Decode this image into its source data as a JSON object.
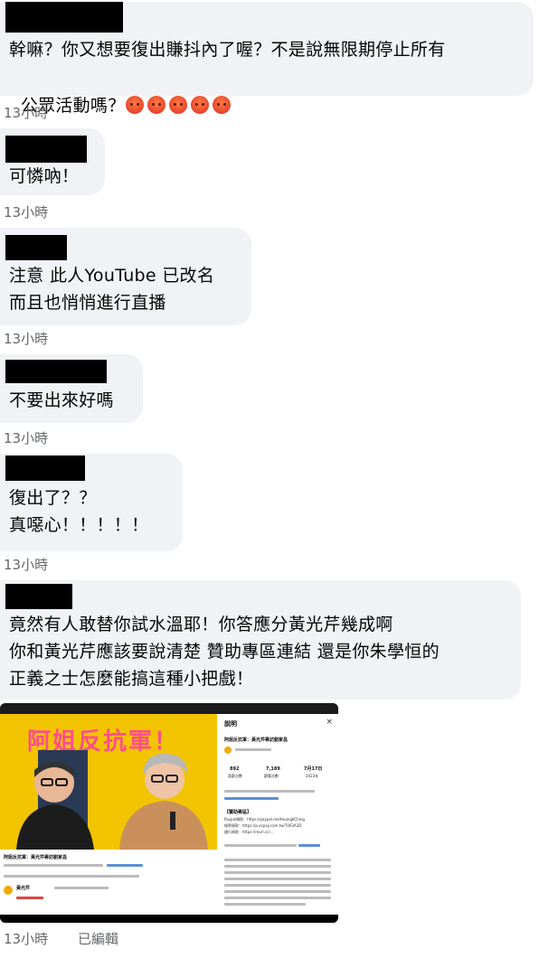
{
  "comments": [
    {
      "lines": [
        "幹嘛？你又想要復出賺抖內了喔？不是說無限期停止所有",
        "公眾活動嗎？"
      ],
      "reaction_emoji": "angry-face",
      "reaction_count_display": 5,
      "time": "13小時"
    },
    {
      "lines": [
        "可憐吶！"
      ],
      "time": "13小時"
    },
    {
      "lines": [
        "注意 此人YouTube 已改名",
        "而且也悄悄進行直播"
      ],
      "time": "13小時"
    },
    {
      "lines": [
        "不要出來好嗎"
      ],
      "time": "13小時"
    },
    {
      "lines": [
        "復出了？？",
        "真噁心！！！！！"
      ],
      "time": "13小時"
    },
    {
      "lines": [
        "竟然有人敢替你試水溫耶！你答應分黃光芹幾成啊",
        "你和黃光芹應該要說清楚 贊助專區連結 還是你朱學恒的",
        "正義之士怎麼能搞這種小把戲！"
      ],
      "time": "13小時",
      "edited": "已編輯"
    }
  ],
  "attachment": {
    "banner_text": "阿姐反抗軍！",
    "panel_title": "說明",
    "panel_close": "×",
    "panel_video_title": "阿姐反抗軍：黃光芹專訪劉家昌",
    "stats": [
      {
        "value": "892",
        "label": "喜歡次數"
      },
      {
        "value": "7,189",
        "label": "觀看次數"
      },
      {
        "value": "7月17日",
        "label": "2023年"
      }
    ],
    "sponsor_heading": "【贊助專區】",
    "sponsor_lines": [
      "Paypal捐款：https://paypal.me/HuangKChing",
      "綠界捐款：https://p.ecpay.com.tw/7063A3D",
      "銀行捐款：https://reurl.cc/..."
    ],
    "channel_name": "阿姐反抗軍：黃光芹專訪劉家昌",
    "bottom_channel": "黃光芹"
  },
  "colors": {
    "bubble": "#f0f2f5",
    "timestamp": "#65676b",
    "text": "#050505",
    "banner_yellow": "#f2c400",
    "banner_pink": "#ff4d8d"
  }
}
